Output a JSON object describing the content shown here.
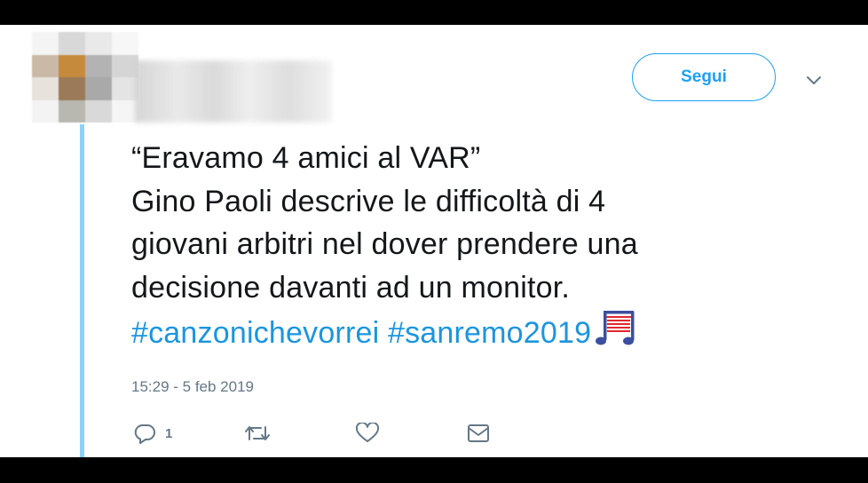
{
  "header": {
    "follow_label": "Segui",
    "more_icon": "chevron-down-icon"
  },
  "tweet": {
    "lines": [
      "“Eravamo 4 amici al VAR”",
      "Gino Paoli descrive le difficoltà di 4",
      "giovani arbitri nel dover prendere una",
      "decisione davanti ad un monitor."
    ],
    "hashtags": [
      "#canzonichevorrei",
      "#sanremo2019"
    ],
    "emoji": "musical-score-icon",
    "timestamp": "15:29 - 5 feb 2019"
  },
  "actions": {
    "reply_icon": "reply-icon",
    "reply_count": "1",
    "retweet_icon": "retweet-icon",
    "like_icon": "heart-icon",
    "dm_icon": "envelope-icon"
  },
  "colors": {
    "accent": "#1da1f2",
    "hashtag": "#1b95e0",
    "text": "#14171a",
    "muted": "#657786",
    "thread": "#8ed0f9"
  }
}
